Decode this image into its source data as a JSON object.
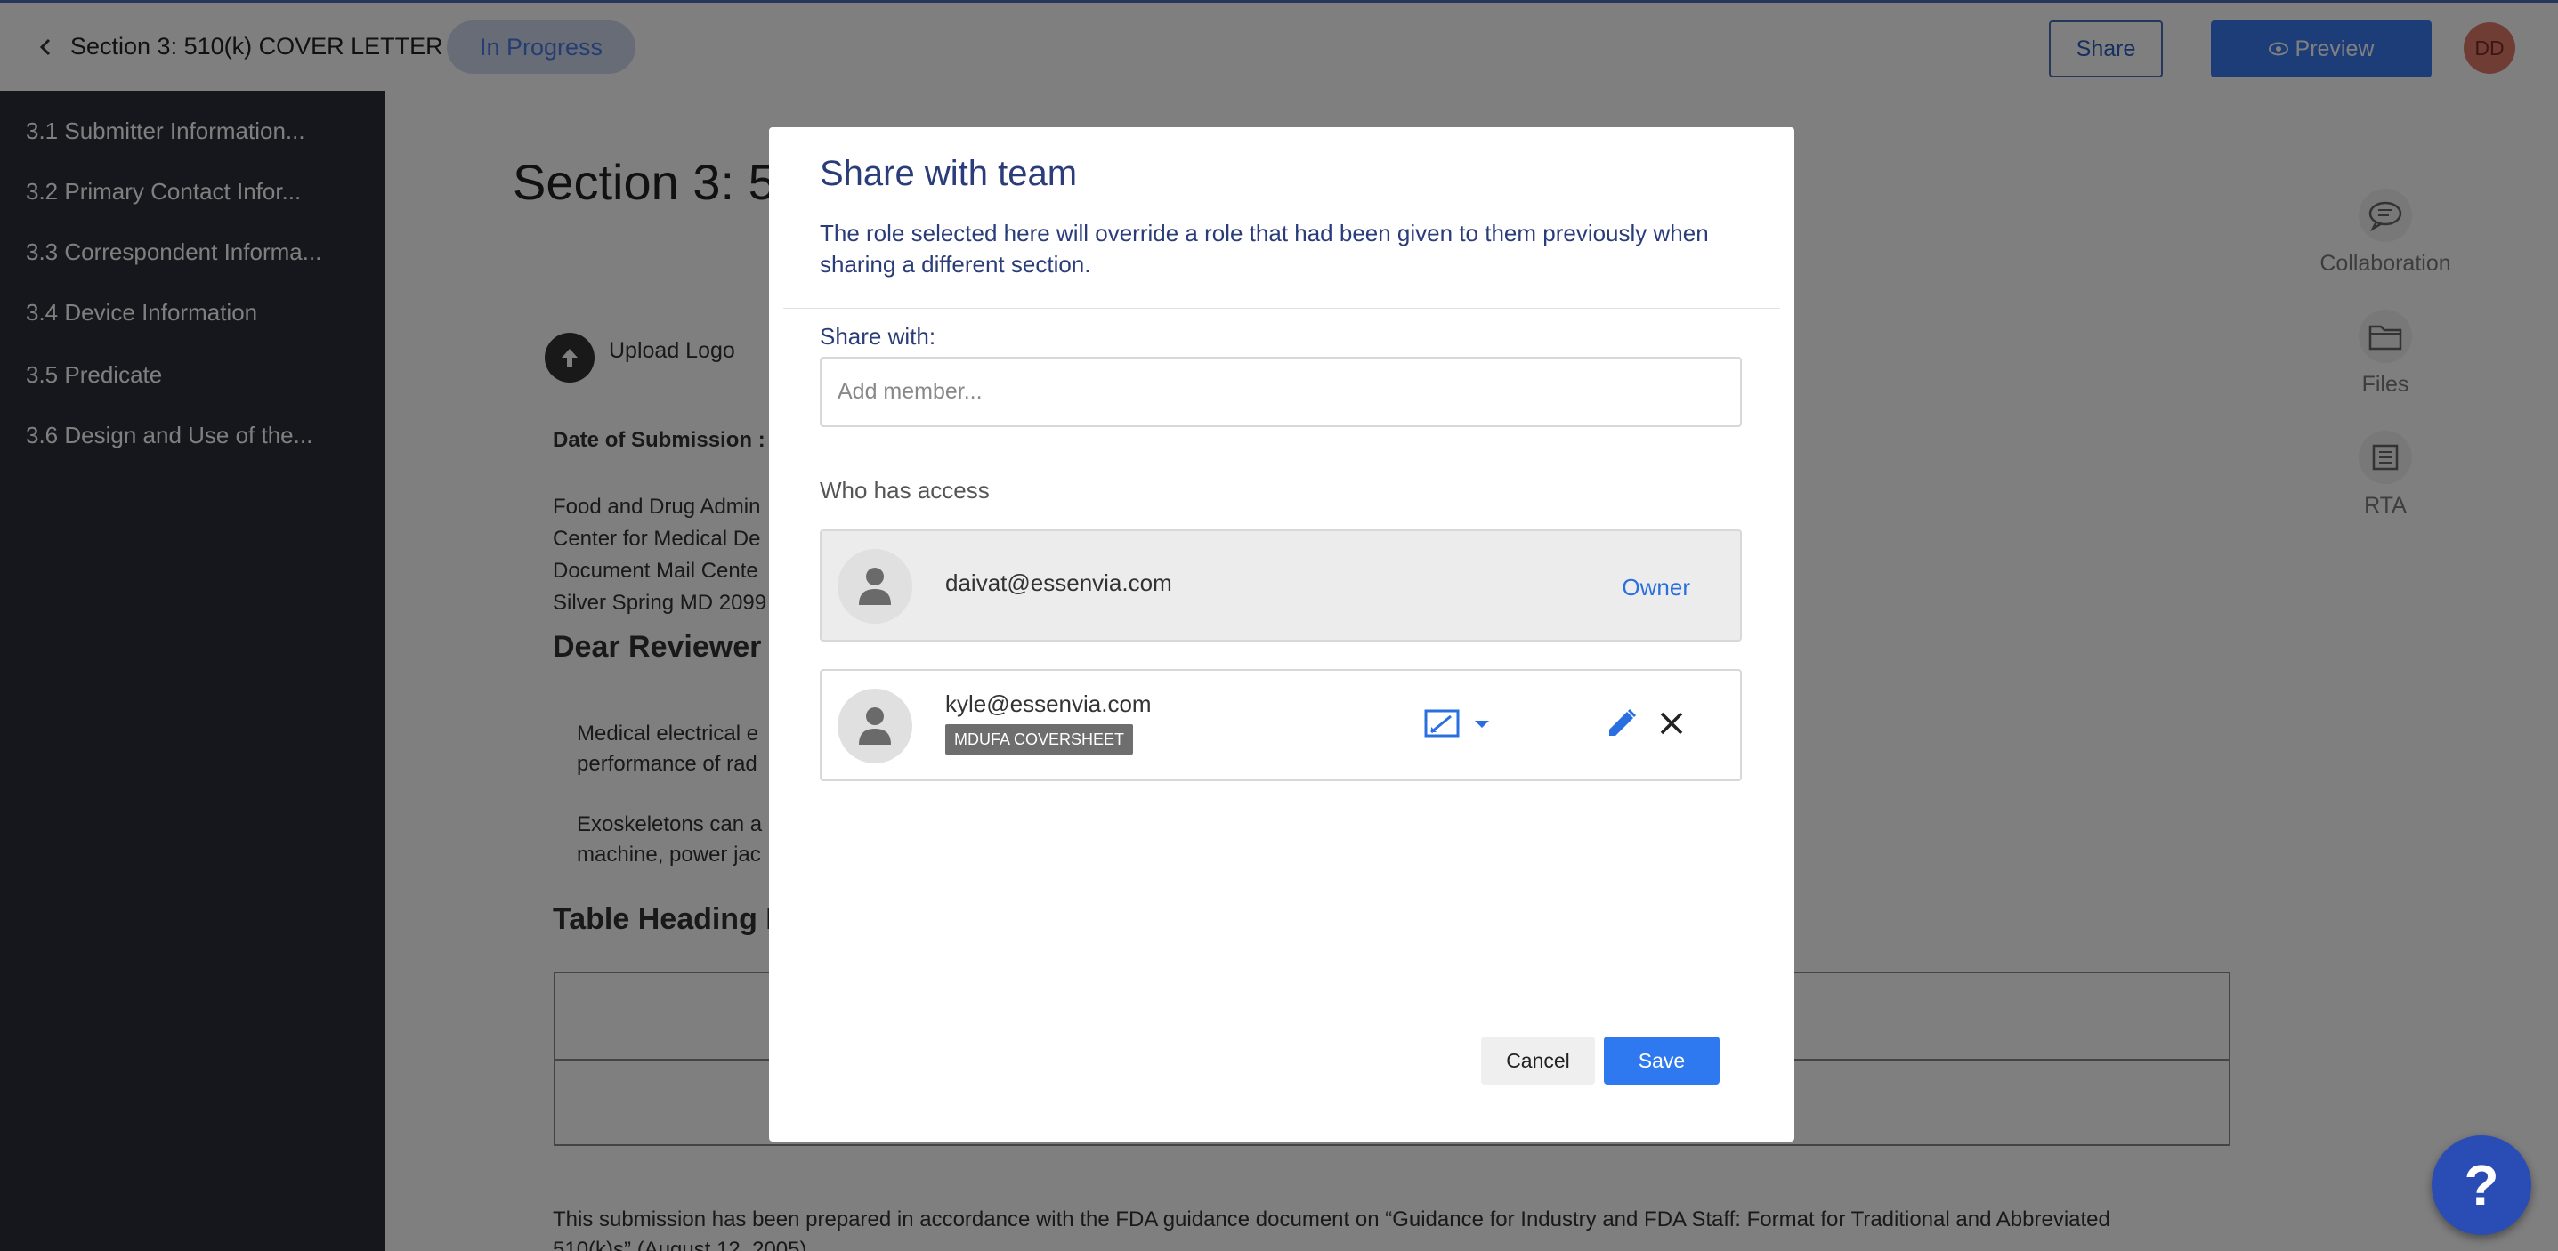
{
  "header": {
    "title": "Section 3:  510(k) COVER LETTER",
    "status": "In Progress",
    "share_label": "Share",
    "preview_label": "Preview",
    "avatar_initials": "DD"
  },
  "sidebar": {
    "items": [
      {
        "label": "3.1 Submitter Information..."
      },
      {
        "label": "3.2 Primary Contact Infor..."
      },
      {
        "label": "3.3 Correspondent Informa..."
      },
      {
        "label": "3.4 Device Information"
      },
      {
        "label": "3.5 Predicate"
      },
      {
        "label": "3.6 Design and Use of the..."
      }
    ]
  },
  "document": {
    "title": "Section 3: 5",
    "upload_logo": "Upload Logo",
    "date_label": "Date of Submission :",
    "address_lines": [
      "Food and Drug Admin",
      "Center for Medical De",
      "Document Mail Cente",
      "Silver Spring MD 2099"
    ],
    "dear": "Dear Reviewer",
    "para1": [
      "Medical electrical e",
      "performance of rad"
    ],
    "para2": [
      "Exoskeletons can a",
      "machine, power jac"
    ],
    "table_heading": "Table Heading H",
    "footer": [
      "This submission has been prepared in accordance with the FDA guidance document on “Guidance for Industry and FDA Staff: Format for Traditional and Abbreviated",
      "510(k)s” (August 12, 2005)"
    ]
  },
  "rail": {
    "items": [
      {
        "label": "Collaboration",
        "icon": "chat-icon"
      },
      {
        "label": "Files",
        "icon": "folder-icon"
      },
      {
        "label": "RTA",
        "icon": "list-icon"
      }
    ]
  },
  "modal": {
    "title": "Share with team",
    "description": "The role selected here will override a role that had been given to them previously when sharing a different section.",
    "share_with_label": "Share with:",
    "member_placeholder": "Add member...",
    "who_has_access_label": "Who has access",
    "members": [
      {
        "email": "daivat@essenvia.com",
        "role": "Owner"
      },
      {
        "email": "kyle@essenvia.com",
        "section": "MDUFA COVERSHEET"
      }
    ],
    "cancel_label": "Cancel",
    "save_label": "Save"
  },
  "help": {
    "label": "?"
  },
  "colors": {
    "accent": "#2f79f0",
    "modal_text": "#2a3d7a",
    "sidebar_bg": "#2c2f3b",
    "overlay": "rgba(0,0,0,0.5)"
  }
}
